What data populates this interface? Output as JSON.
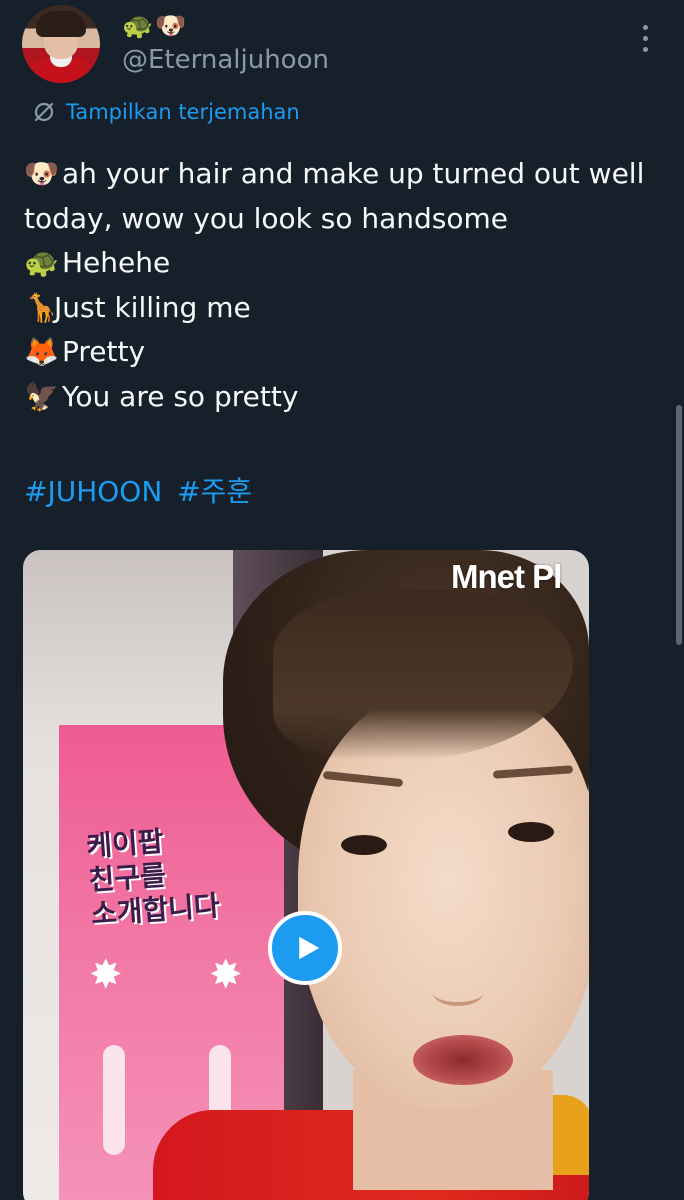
{
  "tweet": {
    "display_name": "🐢🐶",
    "handle": "@Eternaljuhoon",
    "translate_label": "Tampilkan terjemahan",
    "lines": [
      {
        "emoji": "🐶",
        "text": "ah your hair and make up turned out well today, wow you look so handsome"
      },
      {
        "emoji": "🐢",
        "text": "Hehehe"
      },
      {
        "emoji": "🦒",
        "text": "Just killing me"
      },
      {
        "emoji": "🦊",
        "text": "Pretty"
      },
      {
        "emoji": "🦅",
        "text": "You are so pretty"
      }
    ],
    "hashtags": [
      "#JUHOON",
      "#주훈"
    ]
  },
  "media": {
    "watermark": "Mnet Pl",
    "poster_text": "케이팝\n친구를\n소개합니다",
    "play_icon": "play-icon"
  },
  "icons": {
    "translate": "translate-icon",
    "more": "more-options-icon"
  },
  "colors": {
    "background": "#15202b",
    "link": "#1d9bf0",
    "secondary_text": "#8b98a5",
    "primary_text": "#f7f9f9"
  }
}
